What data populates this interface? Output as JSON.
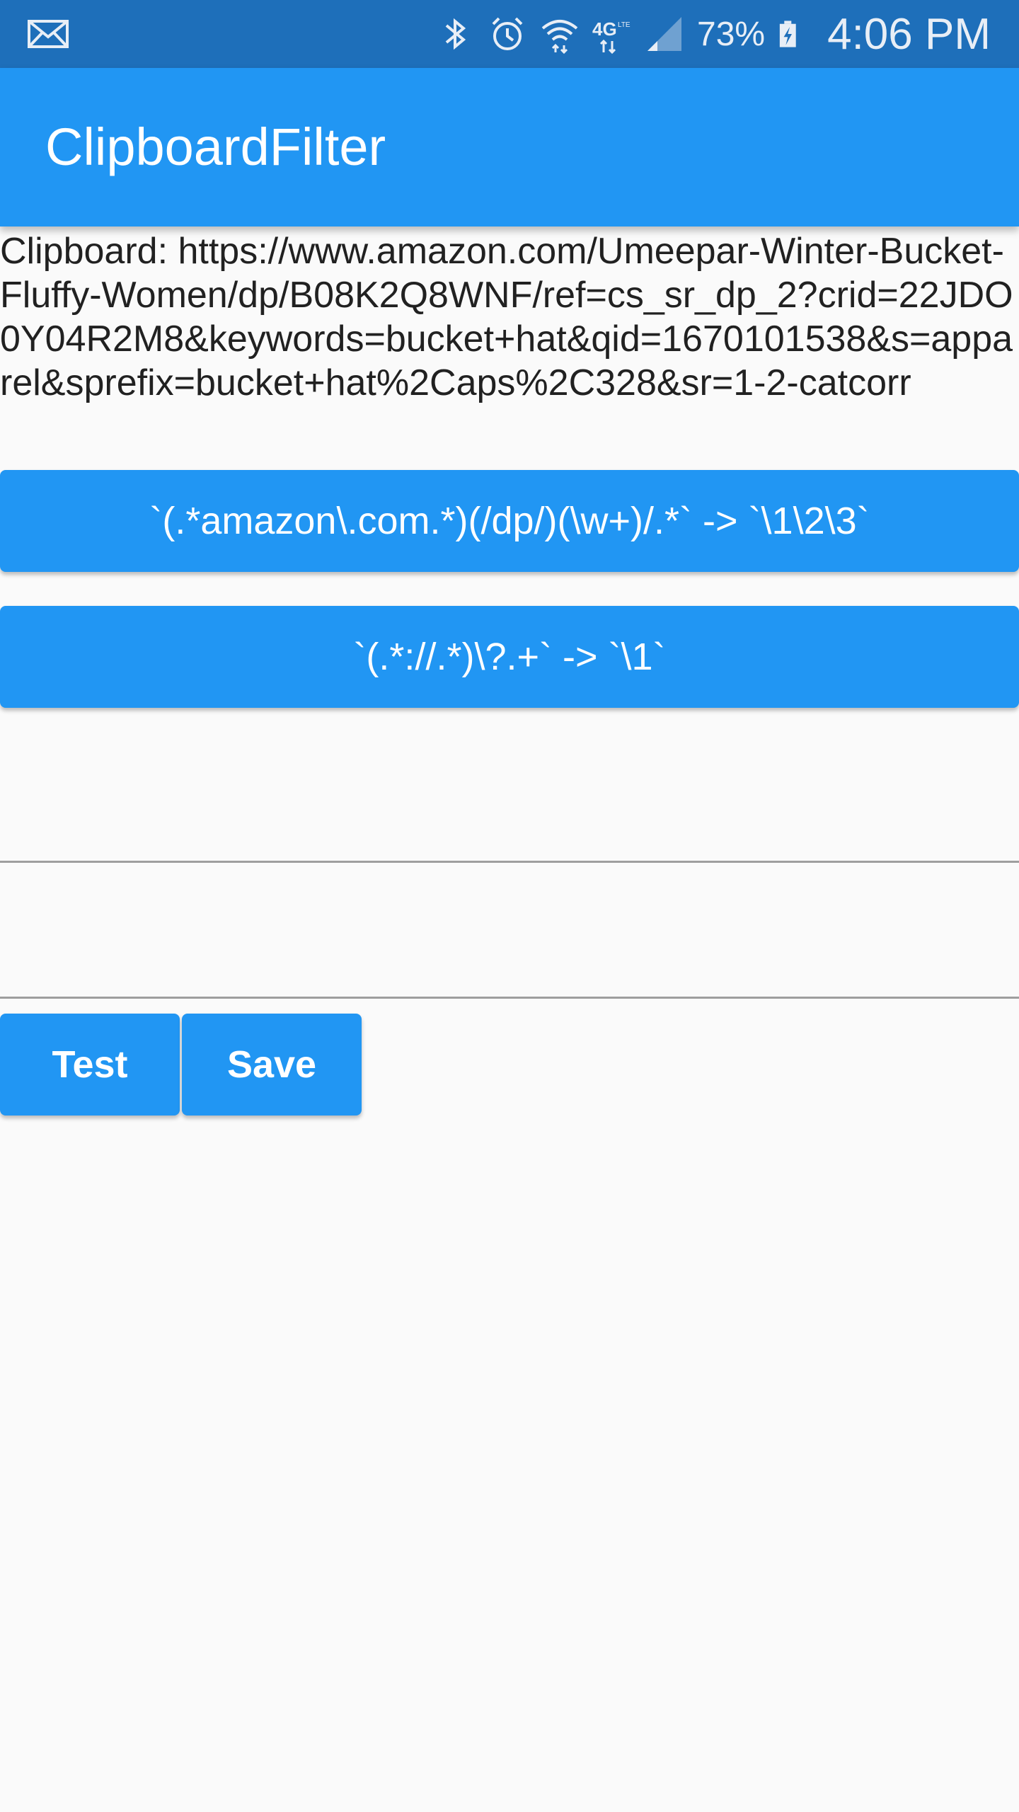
{
  "status_bar": {
    "battery": "73%",
    "time": "4:06 PM",
    "icons": [
      "mail-icon",
      "bluetooth-icon",
      "alarm-icon",
      "wifi-icon",
      "lte-icon",
      "signal-icon",
      "battery-charging-icon"
    ],
    "network_label": "4G"
  },
  "app_bar": {
    "title": "ClipboardFilter"
  },
  "clipboard": {
    "text": "Clipboard: https://www.amazon.com/Umeepar-Winter-Bucket-Fluffy-Women/dp/B08K2Q8WNF/ref=cs_sr_dp_2?crid=22JDO0Y04R2M8&keywords=bucket+hat&qid=1670101538&s=apparel&sprefix=bucket+hat%2Caps%2C328&sr=1-2-catcorr"
  },
  "rules": [
    {
      "label": "`(.*amazon\\.com.*)(/dp/)(\\w+)/.*` -> `\\1\\2\\3`"
    },
    {
      "label": "`(.*://.*)\\?.+` -> `\\1`"
    }
  ],
  "inputs": {
    "pattern_value": "",
    "replacement_value": ""
  },
  "actions": {
    "test_label": "Test",
    "save_label": "Save"
  },
  "colors": {
    "status_bar": "#1e6fba",
    "primary": "#2196f3",
    "background": "#fafafa"
  }
}
